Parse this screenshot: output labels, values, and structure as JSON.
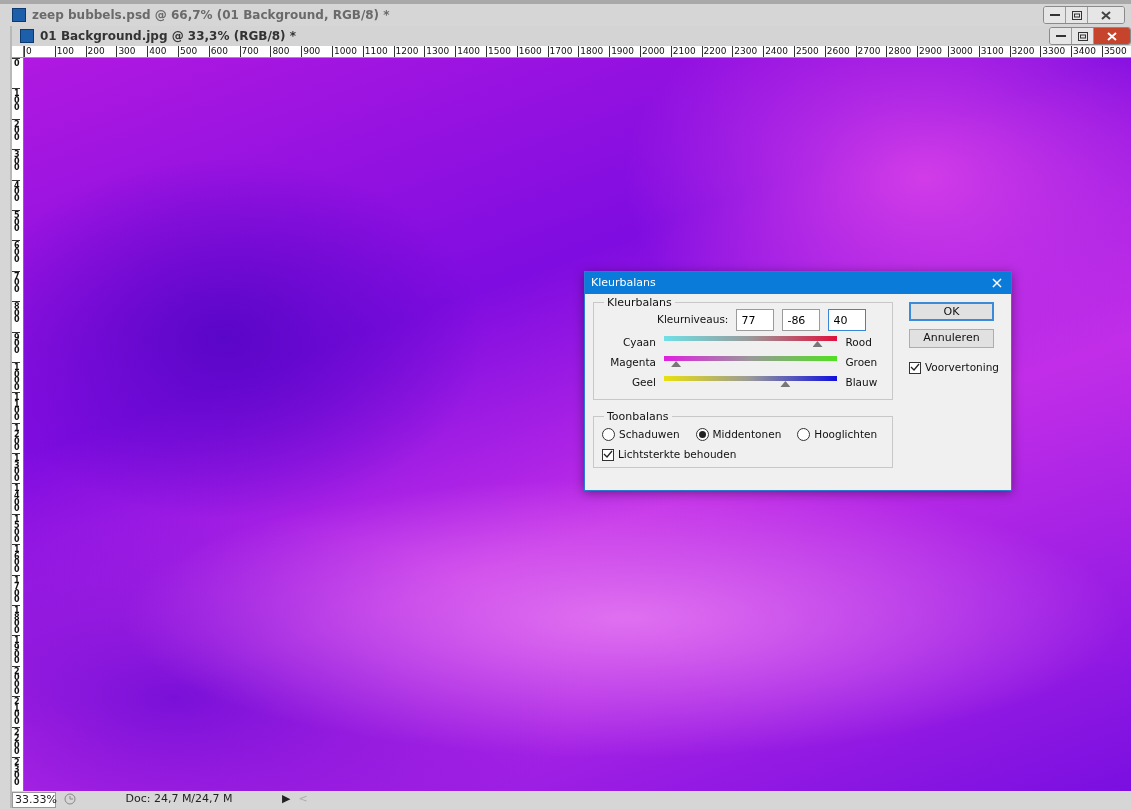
{
  "app_window": {
    "title": "zeep bubbels.psd @ 66,7% (01 Background, RGB/8) *"
  },
  "document_window": {
    "title": "01 Background.jpg @ 33,3% (RGB/8) *"
  },
  "horizontal_ruler": [
    "0",
    "100",
    "200",
    "300",
    "400",
    "500",
    "600",
    "700",
    "800",
    "900",
    "1000",
    "1100",
    "1200",
    "1300",
    "1400",
    "1500",
    "1600",
    "1700",
    "1800",
    "1900",
    "2000",
    "2100",
    "2200",
    "2300",
    "2400",
    "2500",
    "2600",
    "2700",
    "2800",
    "2900",
    "3000",
    "3100",
    "3200",
    "3300",
    "3400",
    "3500"
  ],
  "vertical_ruler": [
    "0",
    "100",
    "200",
    "300",
    "400",
    "500",
    "600",
    "700",
    "800",
    "900",
    "1000",
    "1100",
    "1200",
    "1300",
    "1400",
    "1500",
    "1600",
    "1700",
    "1800",
    "1900",
    "2000",
    "2100",
    "2200",
    "2300"
  ],
  "dialog": {
    "title": "Kleurbalans",
    "close": "×",
    "color_balance": {
      "legend": "Kleurbalans",
      "levels_label": "Kleurniveaus:",
      "levels": [
        "77",
        "-86",
        "40"
      ],
      "sliders": [
        {
          "left": "Cyaan",
          "right": "Rood",
          "level": 0.885
        },
        {
          "left": "Magenta",
          "right": "Groen",
          "level": 0.07
        },
        {
          "left": "Geel",
          "right": "Blauw",
          "level": 0.7
        }
      ]
    },
    "tone_balance": {
      "legend": "Toonbalans",
      "options": [
        {
          "label": "Schaduwen",
          "selected": false
        },
        {
          "label": "Middentonen",
          "selected": true
        },
        {
          "label": "Hooglichten",
          "selected": false
        }
      ],
      "preserve_luminosity": {
        "label": "Lichtsterkte behouden",
        "checked": true
      }
    },
    "buttons": [
      {
        "label": "OK",
        "default": true
      },
      {
        "label": "Annuleren",
        "default": false
      }
    ],
    "preview": {
      "label": "Voorvertoning",
      "checked": true
    }
  },
  "status_bar": {
    "zoom": "33.33%",
    "doc_info": "Doc: 24,7 M/24,7 M",
    "menu_arrow": "▶",
    "scroll_left": "<"
  }
}
